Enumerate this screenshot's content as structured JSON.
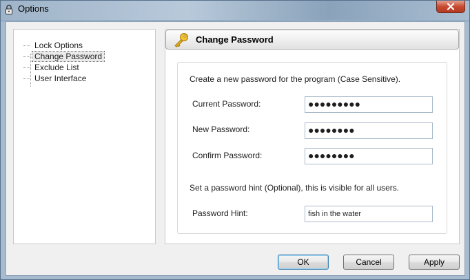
{
  "window": {
    "title": "Options"
  },
  "sidebar": {
    "items": [
      {
        "label": "Lock Options",
        "selected": false
      },
      {
        "label": "Change Password",
        "selected": true
      },
      {
        "label": "Exclude List",
        "selected": false
      },
      {
        "label": "User Interface",
        "selected": false
      }
    ]
  },
  "panel": {
    "title": "Change Password",
    "intro": "Create a new password for the program (Case Sensitive).",
    "fields": {
      "current": {
        "label": "Current Password:",
        "value": "●●●●●●●●●"
      },
      "new": {
        "label": "New Password:",
        "value": "●●●●●●●●"
      },
      "confirm": {
        "label": "Confirm Password:",
        "value": "●●●●●●●●"
      }
    },
    "hint_intro": "Set a password hint (Optional), this is visible for all users.",
    "hint": {
      "label": "Password Hint:",
      "value": "fish in the water"
    }
  },
  "buttons": {
    "ok": "OK",
    "cancel": "Cancel",
    "apply": "Apply"
  },
  "colors": {
    "title_bar": "#a9bdd2",
    "close_button": "#c74b32",
    "key_icon": "#e6b020",
    "client_bg": "#f0f0f0"
  }
}
